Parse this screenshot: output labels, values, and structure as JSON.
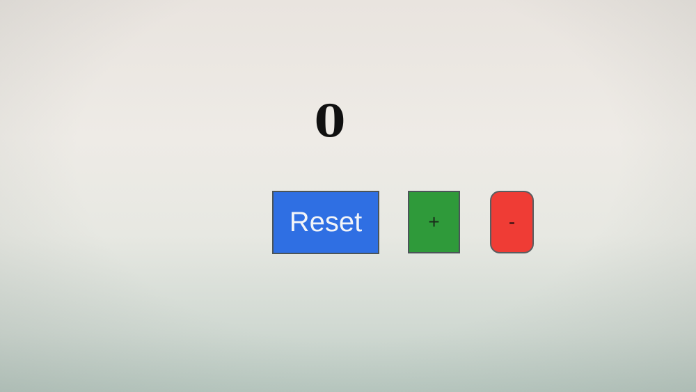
{
  "counter": {
    "value": "0"
  },
  "buttons": {
    "reset_label": "Reset",
    "plus_label": "+",
    "minus_label": "-"
  },
  "colors": {
    "reset": "#2f6fe3",
    "plus": "#2f9a3a",
    "minus": "#ef3c35"
  }
}
